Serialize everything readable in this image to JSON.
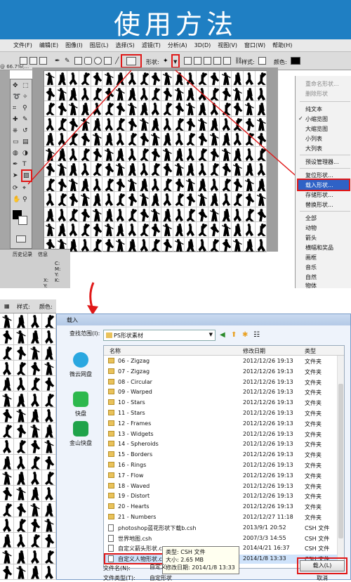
{
  "banner": {
    "title": "使用方法"
  },
  "menubar": {
    "items": [
      "文件(F)",
      "编辑(E)",
      "图像(I)",
      "图层(L)",
      "选择(S)",
      "滤镜(T)",
      "分析(A)",
      "3D(D)",
      "视图(V)",
      "窗口(W)",
      "帮助(H)"
    ]
  },
  "optbar": {
    "shape_label": "形状:",
    "style_label": "样式:",
    "color_label": "颜色:",
    "doc_tab": "@ 66.7%(…"
  },
  "shape_menu": {
    "items": [
      "重命名形状...",
      "删除形状",
      "纯文本",
      "小缩览图",
      "大缩览图",
      "小列表",
      "大列表",
      "预设管理器...",
      "复位形状...",
      "载入形状...",
      "存储形状...",
      "替换形状...",
      "全部",
      "动物",
      "箭头",
      "横幅和奖品",
      "画框",
      "音乐",
      "自然",
      "物体"
    ],
    "checked_item": "小缩览图",
    "highlighted_item": "载入形状..."
  },
  "layers": {
    "tabs": [
      "历史记录",
      "信息"
    ],
    "labels": [
      "C:",
      "M:",
      "Y:",
      "K:",
      "X:",
      "Y:"
    ]
  },
  "optbar2": {
    "style_label": "样式:",
    "color_label": "颜色:"
  },
  "dialog": {
    "title": "载入",
    "look_in_label": "查找范围(I):",
    "current_folder": "PS形状素材",
    "columns": [
      "名称",
      "修改日期",
      "类型"
    ],
    "places": [
      "微云网盘",
      "快盘",
      "金山快盘"
    ],
    "files": [
      {
        "name": "06 - Zigzag",
        "date": "2012/12/26 19:13",
        "type": "文件夹",
        "kind": "folder"
      },
      {
        "name": "07 - Zigzag",
        "date": "2012/12/26 19:13",
        "type": "文件夹",
        "kind": "folder"
      },
      {
        "name": "08 - Circular",
        "date": "2012/12/26 19:13",
        "type": "文件夹",
        "kind": "folder"
      },
      {
        "name": "09 - Warped",
        "date": "2012/12/26 19:13",
        "type": "文件夹",
        "kind": "folder"
      },
      {
        "name": "10 - Stars",
        "date": "2012/12/26 19:13",
        "type": "文件夹",
        "kind": "folder"
      },
      {
        "name": "11 - Stars",
        "date": "2012/12/26 19:13",
        "type": "文件夹",
        "kind": "folder"
      },
      {
        "name": "12 - Frames",
        "date": "2012/12/26 19:13",
        "type": "文件夹",
        "kind": "folder"
      },
      {
        "name": "13 - Widgets",
        "date": "2012/12/26 19:13",
        "type": "文件夹",
        "kind": "folder"
      },
      {
        "name": "14 - Spheroids",
        "date": "2012/12/26 19:13",
        "type": "文件夹",
        "kind": "folder"
      },
      {
        "name": "15 - Borders",
        "date": "2012/12/26 19:13",
        "type": "文件夹",
        "kind": "folder"
      },
      {
        "name": "16 - Rings",
        "date": "2012/12/26 19:13",
        "type": "文件夹",
        "kind": "folder"
      },
      {
        "name": "17 - Flow",
        "date": "2012/12/26 19:13",
        "type": "文件夹",
        "kind": "folder"
      },
      {
        "name": "18 - Waved",
        "date": "2012/12/26 19:13",
        "type": "文件夹",
        "kind": "folder"
      },
      {
        "name": "19 - Distort",
        "date": "2012/12/26 19:13",
        "type": "文件夹",
        "kind": "folder"
      },
      {
        "name": "20 - Hearts",
        "date": "2012/12/26 19:13",
        "type": "文件夹",
        "kind": "folder"
      },
      {
        "name": "21 - Numbers",
        "date": "2012/12/27 11:18",
        "type": "文件夹",
        "kind": "folder"
      },
      {
        "name": "photoshop蓝花形状下载b.csh",
        "date": "2013/9/1 20:52",
        "type": "CSH 文件",
        "kind": "file"
      },
      {
        "name": "世界地图.csh",
        "date": "2007/3/3 14:55",
        "type": "CSH 文件",
        "kind": "file"
      },
      {
        "name": "自定义箭头形状.csh",
        "date": "2014/4/21 16:37",
        "type": "CSH 文件",
        "kind": "file"
      },
      {
        "name": "自定义人物形状.csh",
        "date": "2014/1/8 13:33",
        "type": "CSH 文件",
        "kind": "file"
      }
    ],
    "tooltip": {
      "type": "类型: CSH 文件",
      "size": "大小: 2.65 MB",
      "modified": "修改日期: 2014/1/8 13:33"
    },
    "filename_label": "文件名(N):",
    "filename_value": "自定义",
    "filetype_label": "文件类型(T):",
    "filetype_value": "自定形状",
    "load_button": "载入(L)",
    "cancel_button": "取消"
  },
  "colors": {
    "banner": "#1f7fc3",
    "highlight": "#2f62c6",
    "annotation": "#e01818"
  }
}
